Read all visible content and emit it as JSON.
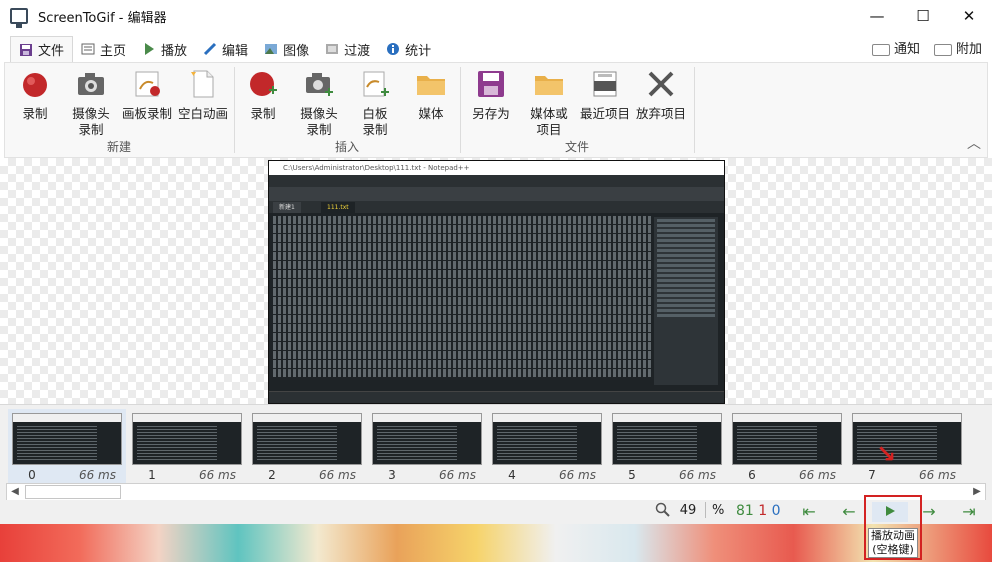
{
  "window": {
    "title": "ScreenToGif - 编辑器",
    "minimize": "—",
    "maximize": "☐",
    "close": "✕"
  },
  "tabs": [
    {
      "label": "文件",
      "icon": "save-icon",
      "active": true
    },
    {
      "label": "主页",
      "icon": "home-icon"
    },
    {
      "label": "播放",
      "icon": "play-icon"
    },
    {
      "label": "编辑",
      "icon": "pencil-icon"
    },
    {
      "label": "图像",
      "icon": "image-icon"
    },
    {
      "label": "过渡",
      "icon": "transition-icon"
    },
    {
      "label": "统计",
      "icon": "info-icon"
    }
  ],
  "tabs_right": {
    "notify": "通知",
    "attach": "附加"
  },
  "ribbon": {
    "groups": [
      {
        "label": "新建",
        "buttons": [
          "录制",
          "摄像头\n录制",
          "画板录制",
          "空白动画"
        ]
      },
      {
        "label": "插入",
        "buttons": [
          "录制",
          "摄像头\n录制",
          "白板\n录制",
          "媒体"
        ]
      },
      {
        "label": "文件",
        "buttons": [
          "另存为",
          "媒体或\n项目",
          "最近项目",
          "放弃项目"
        ]
      }
    ]
  },
  "frame_preview": {
    "title_text": "C:\\Users\\Administrator\\Desktop\\111.txt - Notepad++",
    "tab1": "新建1",
    "tab2": "111.txt"
  },
  "timeline": {
    "frames": [
      {
        "index": "0",
        "delay": "66 ms"
      },
      {
        "index": "1",
        "delay": "66 ms"
      },
      {
        "index": "2",
        "delay": "66 ms"
      },
      {
        "index": "3",
        "delay": "66 ms"
      },
      {
        "index": "4",
        "delay": "66 ms"
      },
      {
        "index": "5",
        "delay": "66 ms"
      },
      {
        "index": "6",
        "delay": "66 ms"
      },
      {
        "index": "7",
        "delay": "66 ms"
      }
    ]
  },
  "status": {
    "zoom_value": "49",
    "zoom_unit": "%",
    "frame_count": "81",
    "selected_count": "1",
    "current_index": "0",
    "play_tooltip_line1": "播放动画",
    "play_tooltip_line2": "(空格键)"
  },
  "colors": {
    "accent": "#2a6fbf",
    "record_red": "#c2282a",
    "nav_green": "#3f8b3f",
    "highlight_red": "#d32222",
    "save_purple": "#8e3b8e",
    "folder_yellow": "#e9b04a"
  }
}
